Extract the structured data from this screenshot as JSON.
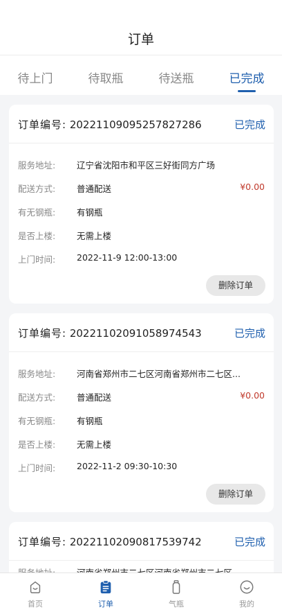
{
  "header": {
    "title": "订单"
  },
  "tabs": [
    {
      "label": "待上门"
    },
    {
      "label": "待取瓶"
    },
    {
      "label": "待送瓶"
    },
    {
      "label": "已完成"
    }
  ],
  "orders": [
    {
      "no_label": "订单编号:",
      "no": "20221109095257827286",
      "status": "已完成",
      "address_label": "服务地址:",
      "address": "辽宁省沈阳市和平区三好街同方广场",
      "delivery_label": "配送方式:",
      "delivery": "普通配送",
      "price": "¥0.00",
      "cylinder_label": "有无钢瓶:",
      "cylinder": "有钢瓶",
      "stairs_label": "是否上楼:",
      "stairs": "无需上楼",
      "time_label": "上门时间:",
      "time": "2022-11-9 12:00-13:00",
      "delete_label": "删除订单"
    },
    {
      "no_label": "订单编号:",
      "no": "20221102091058974543",
      "status": "已完成",
      "address_label": "服务地址:",
      "address": "河南省郑州市二七区河南省郑州市二七区...",
      "delivery_label": "配送方式:",
      "delivery": "普通配送",
      "price": "¥0.00",
      "cylinder_label": "有无钢瓶:",
      "cylinder": "有钢瓶",
      "stairs_label": "是否上楼:",
      "stairs": "无需上楼",
      "time_label": "上门时间:",
      "time": "2022-11-2 09:30-10:30",
      "delete_label": "删除订单"
    },
    {
      "no_label": "订单编号:",
      "no": "20221102090817539742",
      "status": "已完成",
      "address_label": "服务地址:",
      "address": "河南省郑州市二七区河南省郑州市二七区"
    }
  ],
  "tabbar": [
    {
      "label": "首页",
      "icon": "home-icon"
    },
    {
      "label": "订单",
      "icon": "clipboard-icon"
    },
    {
      "label": "气瓶",
      "icon": "gas-bottle-icon"
    },
    {
      "label": "我的",
      "icon": "smile-icon"
    }
  ],
  "colors": {
    "accent": "#1f5fae",
    "price": "#c0392b"
  }
}
